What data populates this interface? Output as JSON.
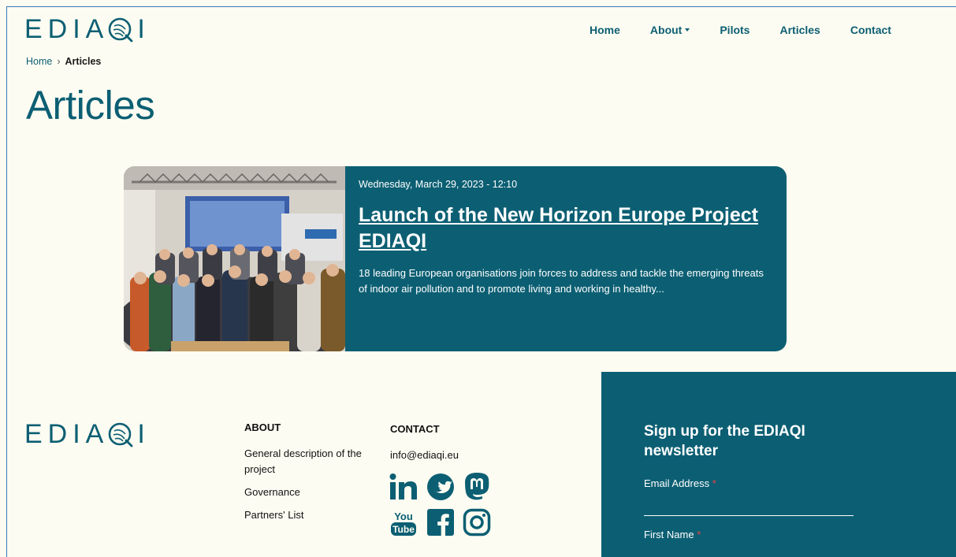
{
  "brand": {
    "logo_text_left": "EDIA",
    "logo_text_right": "I",
    "logo_aria": "EDIAQI"
  },
  "nav": {
    "items": [
      {
        "label": "Home"
      },
      {
        "label": "About",
        "dropdown": true
      },
      {
        "label": "Pilots"
      },
      {
        "label": "Articles"
      },
      {
        "label": "Contact"
      }
    ]
  },
  "breadcrumb": {
    "home": "Home",
    "separator": "›",
    "current": "Articles"
  },
  "page": {
    "title": "Articles"
  },
  "article": {
    "date": "Wednesday, March 29, 2023 - 12:10",
    "title": "Launch of the New Horizon Europe Project EDIAQI",
    "excerpt": "18 leading European organisations join forces to address and tackle the emerging threats of indoor air pollution and to promote living and working in healthy..."
  },
  "footer": {
    "about": {
      "heading": "ABOUT",
      "links": [
        "General description of the project",
        "Governance",
        "Partners' List"
      ]
    },
    "contact": {
      "heading": "CONTACT",
      "email": "info@ediaqi.eu"
    },
    "social": [
      "linkedin-icon",
      "twitter-icon",
      "mastodon-icon",
      "youtube-icon",
      "facebook-icon",
      "instagram-icon"
    ]
  },
  "newsletter": {
    "title": "Sign up for the EDIAQI newsletter",
    "email_label": "Email Address",
    "first_name_label": "First Name",
    "required_mark": "*"
  },
  "colors": {
    "brand": "#0c5f73",
    "background": "#fdfcf2",
    "required": "#e44444"
  }
}
